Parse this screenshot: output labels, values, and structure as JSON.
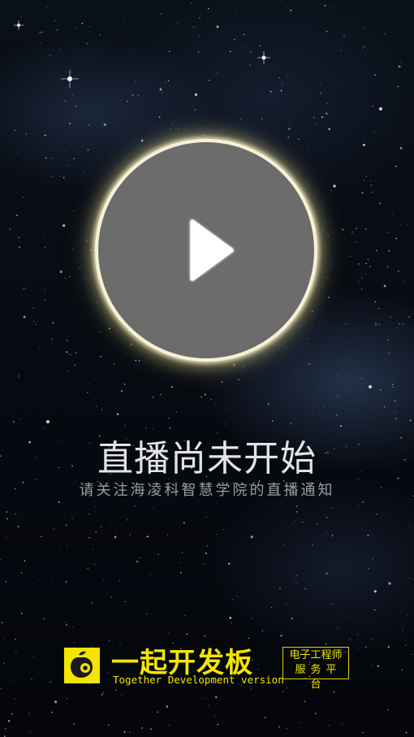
{
  "player": {
    "title": "直播尚未开始",
    "subtitle": "请关注海凌科智慧学院的直播通知"
  },
  "brand": {
    "name": "一起开发板",
    "tagline": "Together Development version",
    "badge_line1": "电子工程师",
    "badge_line2": "服务平台",
    "accent_color": "#f3e500"
  },
  "icons": {
    "play": "play-icon",
    "logo": "fruit-logo-icon"
  },
  "colors": {
    "background": "#05080f",
    "circle_fill": "#6c6c6c",
    "ring_glow": "#f6f2d8"
  }
}
